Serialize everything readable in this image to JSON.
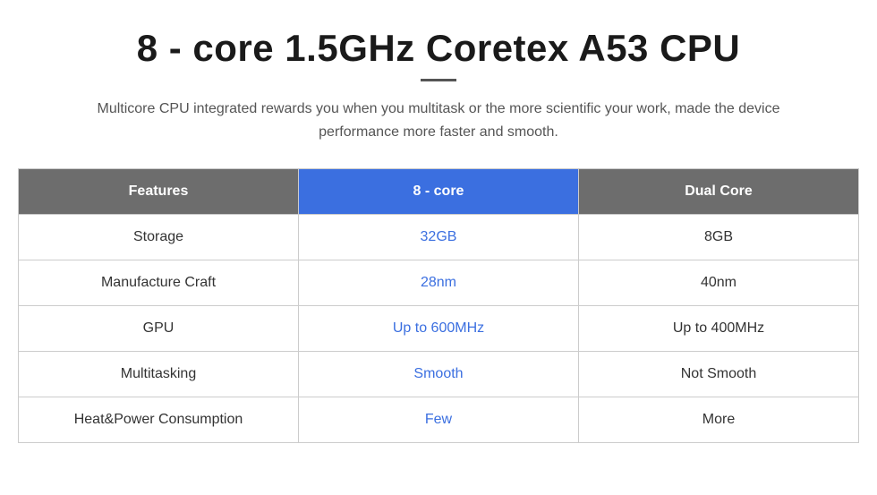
{
  "header": {
    "title": "8 - core 1.5GHz Coretex A53 CPU",
    "subtitle": "Multicore CPU integrated rewards you when you multitask or the more scientific your work, made the device performance more faster and smooth."
  },
  "table": {
    "headers": {
      "features": "Features",
      "col1": "8 - core",
      "col2": "Dual Core"
    },
    "rows": [
      {
        "feature": "Storage",
        "val1": "32GB",
        "val2": "8GB"
      },
      {
        "feature": "Manufacture Craft",
        "val1": "28nm",
        "val2": "40nm"
      },
      {
        "feature": "GPU",
        "val1": "Up to 600MHz",
        "val2": "Up to 400MHz"
      },
      {
        "feature": "Multitasking",
        "val1": "Smooth",
        "val2": "Not Smooth"
      },
      {
        "feature": "Heat&Power Consumption",
        "val1": "Few",
        "val2": "More"
      }
    ]
  }
}
